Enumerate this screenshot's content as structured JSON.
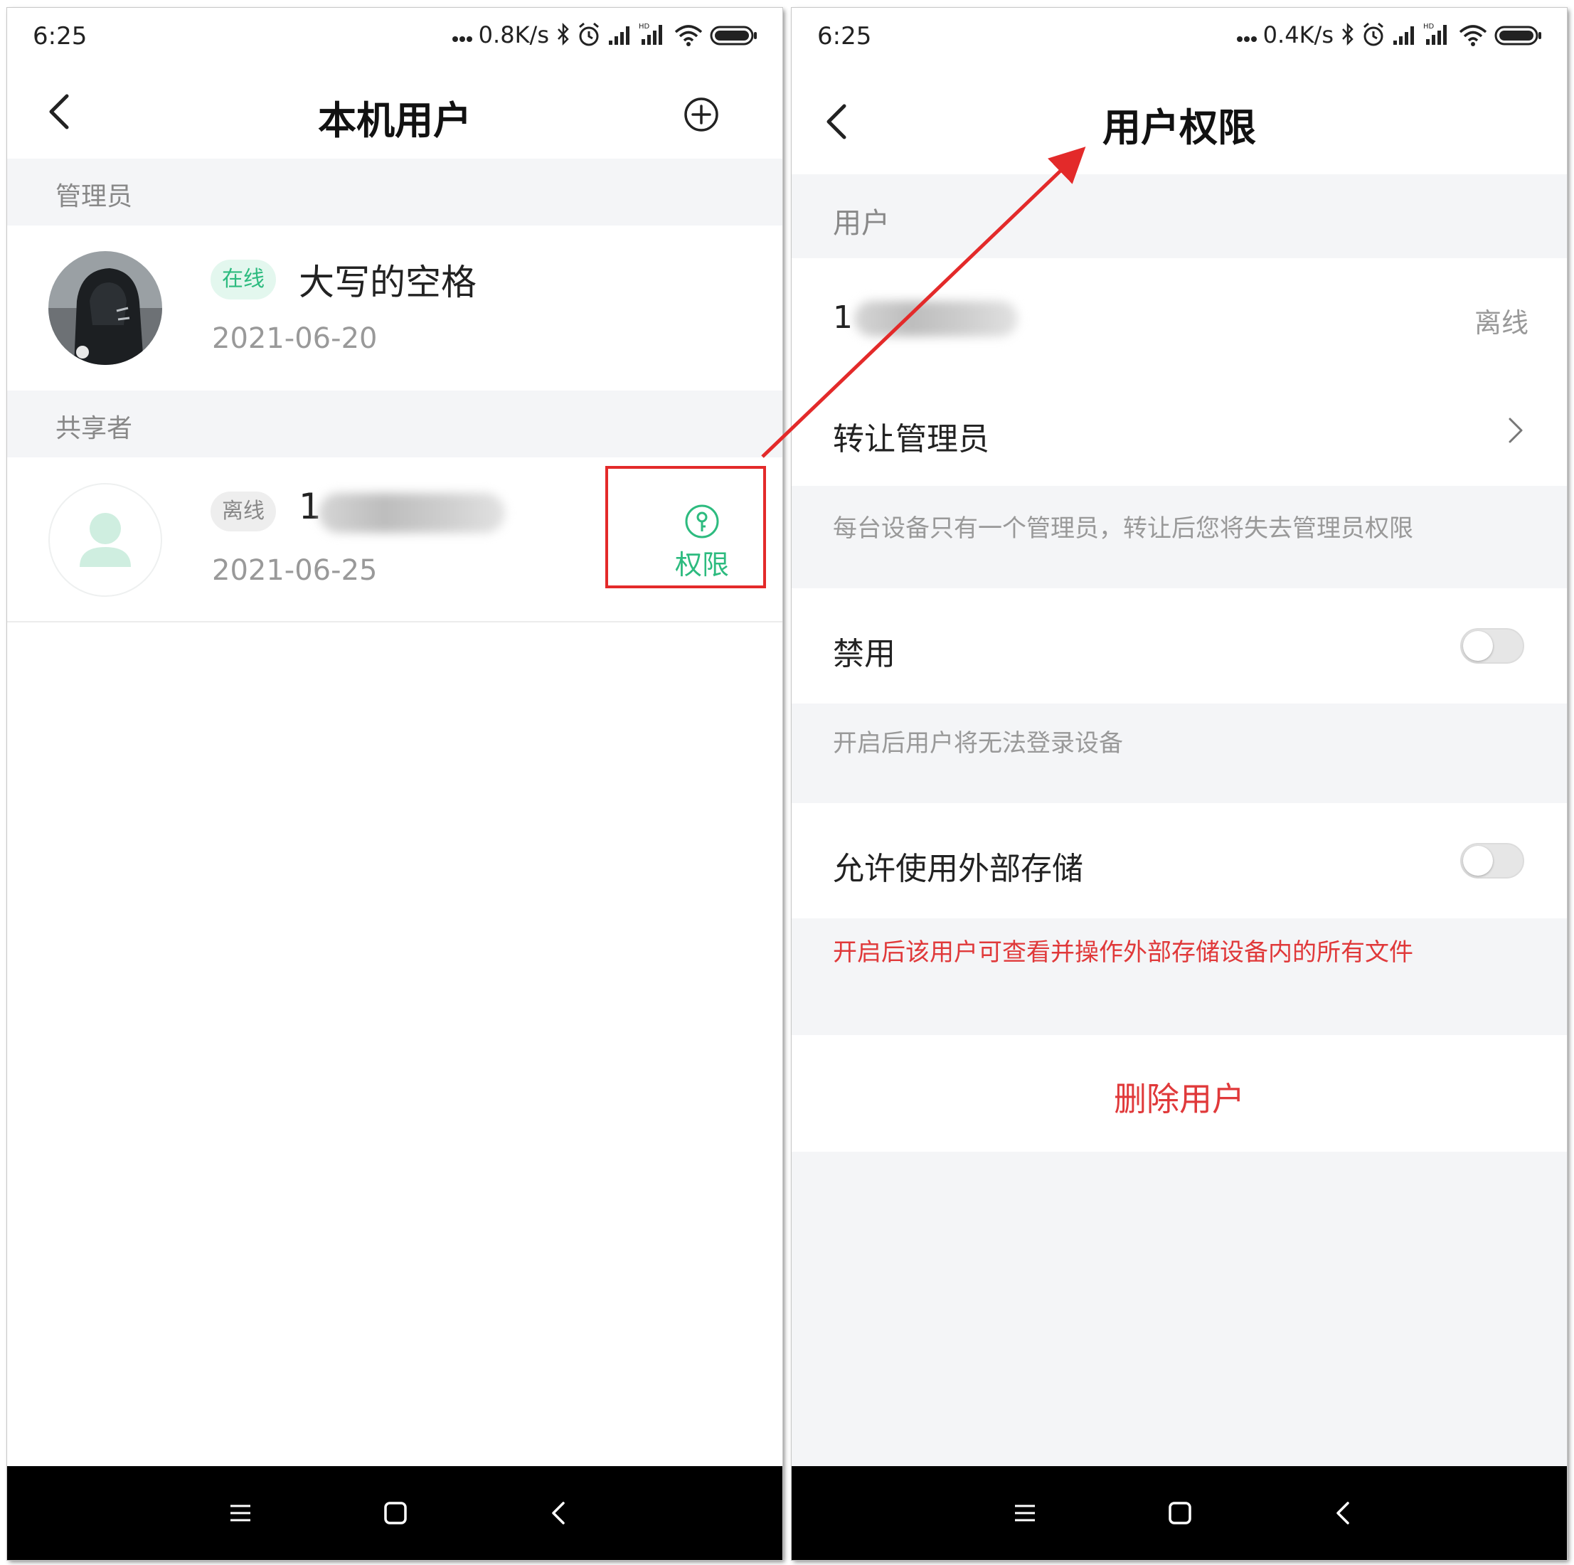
{
  "left": {
    "status": {
      "time": "6:25",
      "speed": "0.8K/s"
    },
    "header": {
      "title": "本机用户"
    },
    "admin_section": {
      "label": "管理员"
    },
    "admin_user": {
      "status": "在线",
      "name": "大写的空格",
      "date": "2021-06-20"
    },
    "sharer_section": {
      "label": "共享者"
    },
    "sharer_user": {
      "status": "离线",
      "name_prefix": "1",
      "date": "2021-06-25",
      "action_label": "权限"
    }
  },
  "right": {
    "status": {
      "time": "6:25",
      "speed": "0.4K/s"
    },
    "header": {
      "title": "用户权限"
    },
    "user_section": {
      "label": "用户"
    },
    "user_row": {
      "name_prefix": "1",
      "status": "离线"
    },
    "transfer_row": {
      "label": "转让管理员"
    },
    "transfer_hint": "每台设备只有一个管理员，转让后您将失去管理员权限",
    "disable_row": {
      "label": "禁用",
      "enabled": false
    },
    "disable_hint": "开启后用户将无法登录设备",
    "storage_row": {
      "label": "允许使用外部存储",
      "enabled": false
    },
    "storage_hint": "开启后该用户可查看并操作外部存储设备内的所有文件",
    "delete_label": "删除用户"
  },
  "colors": {
    "accent_green": "#2dbb7f",
    "danger_red": "#e0393a",
    "annotation_red": "#e32a2a"
  }
}
